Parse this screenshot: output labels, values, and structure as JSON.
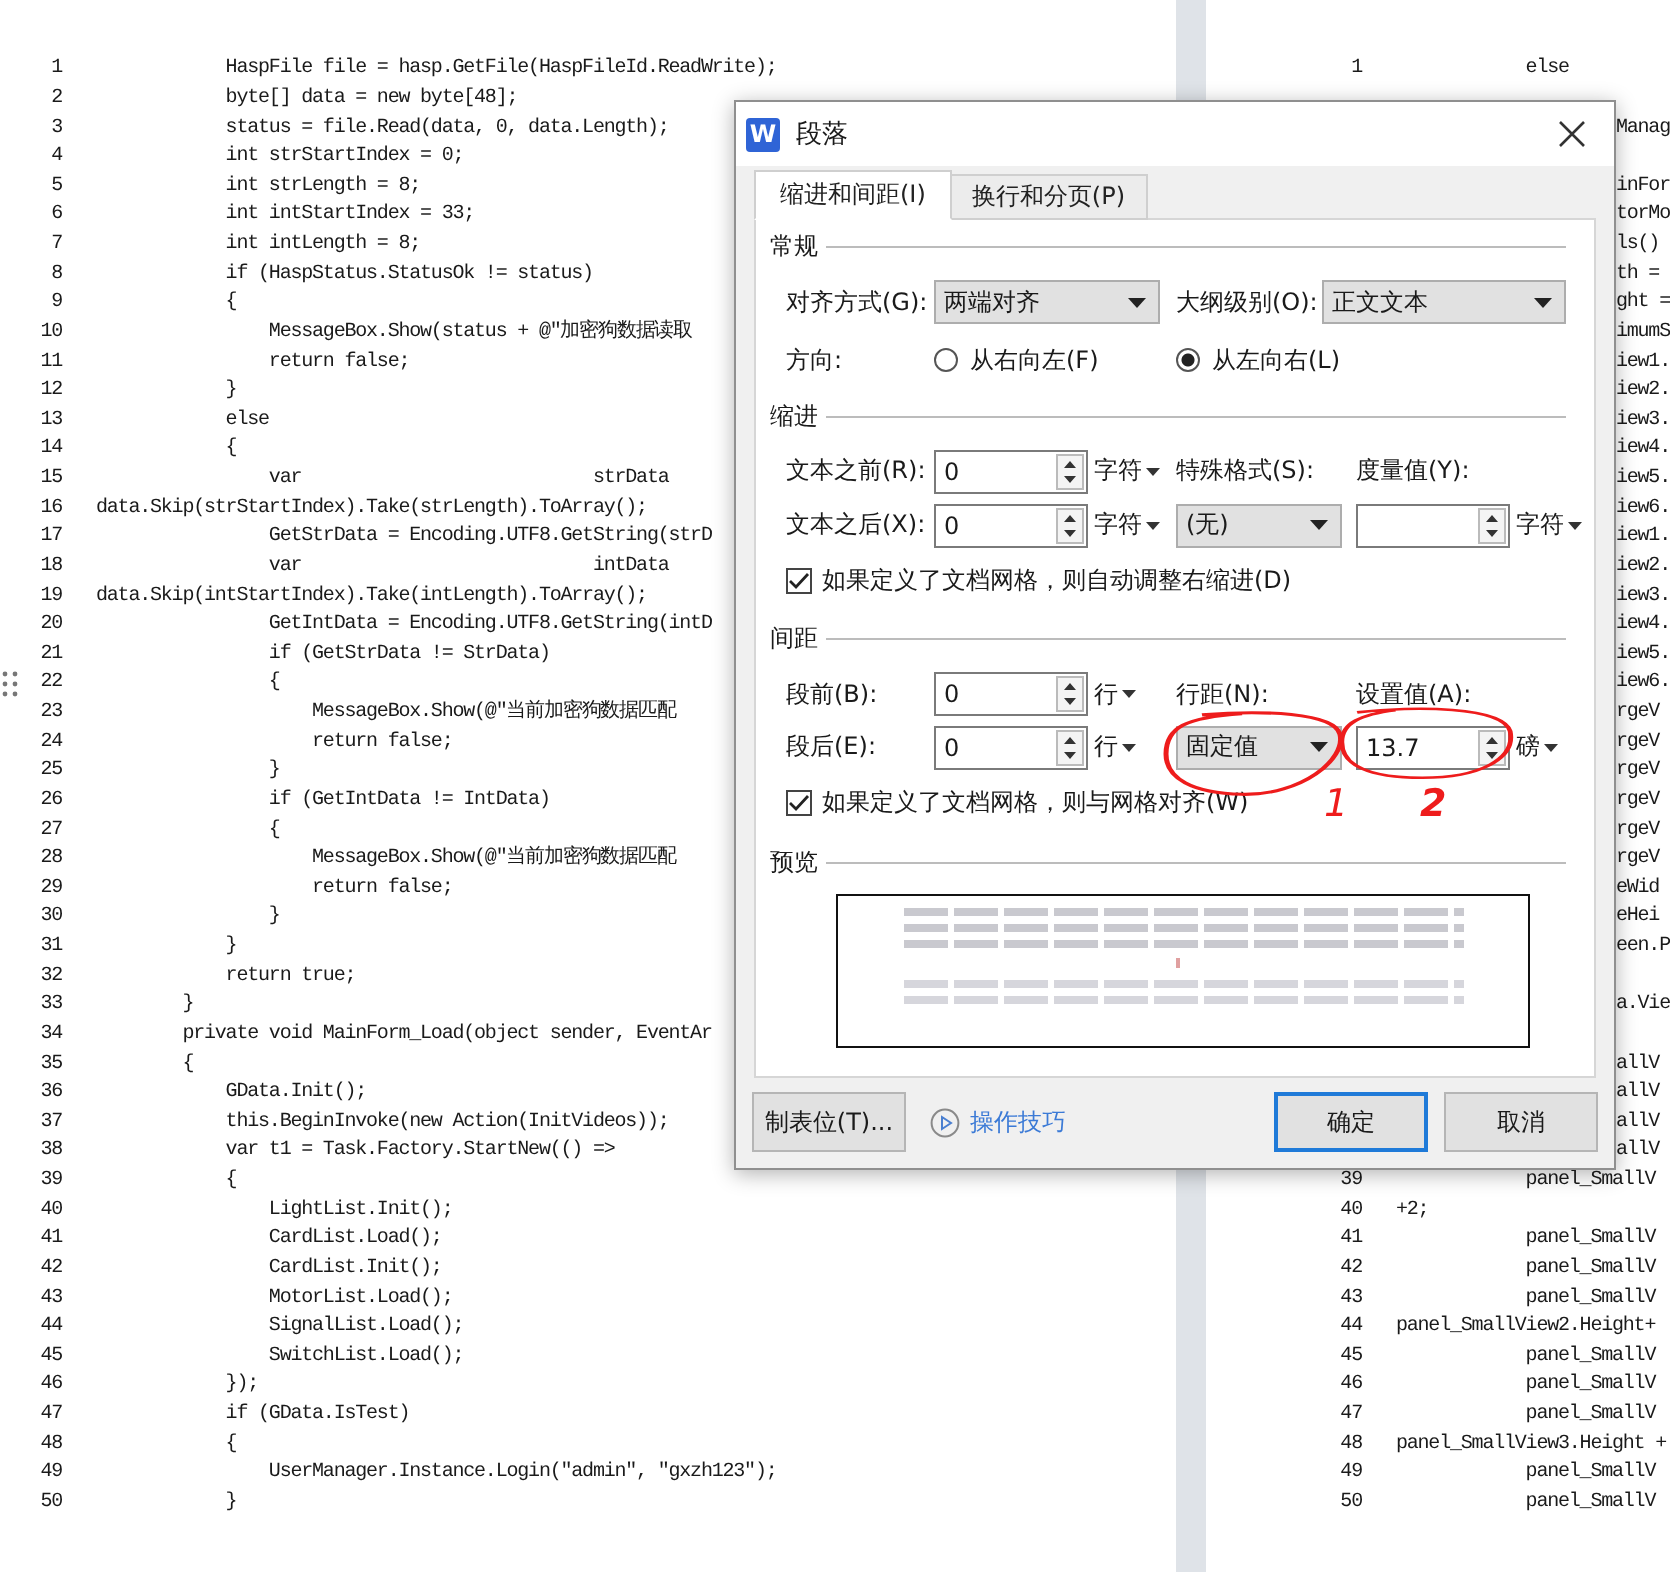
{
  "left_page": {
    "lines": [
      {
        "number": "1",
        "text": "            HaspFile file = hasp.GetFile(HaspFileId.ReadWrite);"
      },
      {
        "number": "2",
        "text": "            byte[] data = new byte[48];"
      },
      {
        "number": "3",
        "text": "            status = file.Read(data, 0, data.Length);"
      },
      {
        "number": "4",
        "text": "            int strStartIndex = 0;"
      },
      {
        "number": "5",
        "text": "            int strLength = 8;"
      },
      {
        "number": "6",
        "text": "            int intStartIndex = 33;"
      },
      {
        "number": "7",
        "text": "            int intLength = 8;"
      },
      {
        "number": "8",
        "text": "            if (HaspStatus.StatusOk != status)"
      },
      {
        "number": "9",
        "text": "            {"
      },
      {
        "number": "10",
        "text": "                MessageBox.Show(status + @\"加密狗数据读取"
      },
      {
        "number": "11",
        "text": "                return false;"
      },
      {
        "number": "12",
        "text": "            }"
      },
      {
        "number": "13",
        "text": "            else"
      },
      {
        "number": "14",
        "text": "            {"
      },
      {
        "number": "15",
        "text": "                var                           strData"
      },
      {
        "number": "16",
        "text": "data.Skip(strStartIndex).Take(strLength).ToArray();"
      },
      {
        "number": "17",
        "text": "                GetStrData = Encoding.UTF8.GetString(strD"
      },
      {
        "number": "18",
        "text": "                var                           intData"
      },
      {
        "number": "19",
        "text": "data.Skip(intStartIndex).Take(intLength).ToArray();"
      },
      {
        "number": "20",
        "text": "                GetIntData = Encoding.UTF8.GetString(intD"
      },
      {
        "number": "21",
        "text": "                if (GetStrData != StrData)"
      },
      {
        "number": "22",
        "text": "                {"
      },
      {
        "number": "23",
        "text": "                    MessageBox.Show(@\"当前加密狗数据匹配"
      },
      {
        "number": "24",
        "text": "                    return false;"
      },
      {
        "number": "25",
        "text": "                }"
      },
      {
        "number": "26",
        "text": "                if (GetIntData != IntData)"
      },
      {
        "number": "27",
        "text": "                {"
      },
      {
        "number": "28",
        "text": "                    MessageBox.Show(@\"当前加密狗数据匹配"
      },
      {
        "number": "29",
        "text": "                    return false;"
      },
      {
        "number": "30",
        "text": "                }"
      },
      {
        "number": "31",
        "text": "            }"
      },
      {
        "number": "32",
        "text": "            return true;"
      },
      {
        "number": "33",
        "text": "        }"
      },
      {
        "number": "34",
        "text": "        private void MainForm_Load(object sender, EventAr"
      },
      {
        "number": "35",
        "text": "        {"
      },
      {
        "number": "36",
        "text": "            GData.Init();"
      },
      {
        "number": "37",
        "text": "            this.BeginInvoke(new Action(InitVideos));"
      },
      {
        "number": "38",
        "text": "            var t1 = Task.Factory.StartNew(() =>"
      },
      {
        "number": "39",
        "text": "            {"
      },
      {
        "number": "40",
        "text": "                LightList.Init();"
      },
      {
        "number": "41",
        "text": "                CardList.Load();"
      },
      {
        "number": "42",
        "text": "                CardList.Init();"
      },
      {
        "number": "43",
        "text": "                MotorList.Load();"
      },
      {
        "number": "44",
        "text": "                SignalList.Load();"
      },
      {
        "number": "45",
        "text": "                SwitchList.Load();"
      },
      {
        "number": "46",
        "text": "            });"
      },
      {
        "number": "47",
        "text": "            if (GData.IsTest)"
      },
      {
        "number": "48",
        "text": "            {"
      },
      {
        "number": "49",
        "text": "                UserManager.Instance.Login(\"admin\", \"gxzh123\");"
      },
      {
        "number": "50",
        "text": "            }"
      }
    ]
  },
  "right_page": {
    "lines": [
      {
        "kind": "full",
        "number": "1",
        "text": "            else"
      },
      {
        "kind": "blank"
      },
      {
        "kind": "fragment",
        "text": "Manag"
      },
      {
        "kind": "blank"
      },
      {
        "kind": "fragment",
        "text": "inFor"
      },
      {
        "kind": "fragment",
        "text": "torMo"
      },
      {
        "kind": "fragment",
        "text": "ls()"
      },
      {
        "kind": "fragment",
        "text": "th ="
      },
      {
        "kind": "fragment",
        "text": "ght ="
      },
      {
        "kind": "fragment",
        "text": "imumS"
      },
      {
        "kind": "fragment",
        "text": "iew1."
      },
      {
        "kind": "fragment",
        "text": "iew2."
      },
      {
        "kind": "fragment",
        "text": "iew3."
      },
      {
        "kind": "fragment",
        "text": "iew4."
      },
      {
        "kind": "fragment",
        "text": "iew5."
      },
      {
        "kind": "fragment",
        "text": "iew6."
      },
      {
        "kind": "fragment",
        "text": "iew1."
      },
      {
        "kind": "fragment",
        "text": "iew2."
      },
      {
        "kind": "fragment",
        "text": "iew3."
      },
      {
        "kind": "fragment",
        "text": "iew4."
      },
      {
        "kind": "fragment",
        "text": "iew5."
      },
      {
        "kind": "fragment",
        "text": "iew6."
      },
      {
        "kind": "fragment",
        "text": "rgeV"
      },
      {
        "kind": "fragment",
        "text": "rgeV"
      },
      {
        "kind": "fragment",
        "text": "rgeV"
      },
      {
        "kind": "fragment",
        "text": "rgeV"
      },
      {
        "kind": "fragment",
        "text": "rgeV"
      },
      {
        "kind": "fragment",
        "text": "rgeV"
      },
      {
        "kind": "fragment",
        "text": "eWid"
      },
      {
        "kind": "fragment",
        "text": "eHei"
      },
      {
        "kind": "fragment",
        "text": "een.P"
      },
      {
        "kind": "blank"
      },
      {
        "kind": "fragment",
        "text": "a.Vie"
      },
      {
        "kind": "blank"
      },
      {
        "kind": "fragment",
        "text": "allV"
      },
      {
        "kind": "fragment",
        "text": "allV"
      },
      {
        "kind": "fragment",
        "text": "allV"
      },
      {
        "kind": "fragment",
        "text": "allV"
      },
      {
        "kind": "full",
        "number": "39",
        "text": "            panel_SmallV"
      },
      {
        "kind": "full",
        "number": "40",
        "text": "+2;"
      },
      {
        "kind": "full",
        "number": "41",
        "text": "            panel_SmallV"
      },
      {
        "kind": "full",
        "number": "42",
        "text": "            panel_SmallV"
      },
      {
        "kind": "full",
        "number": "43",
        "text": "            panel_SmallV"
      },
      {
        "kind": "full",
        "number": "44",
        "text": "panel_SmallView2.Height+"
      },
      {
        "kind": "full",
        "number": "45",
        "text": "            panel_SmallV"
      },
      {
        "kind": "full",
        "number": "46",
        "text": "            panel_SmallV"
      },
      {
        "kind": "full",
        "number": "47",
        "text": "            panel_SmallV"
      },
      {
        "kind": "full",
        "number": "48",
        "text": "panel_SmallView3.Height +"
      },
      {
        "kind": "full",
        "number": "49",
        "text": "            panel_SmallV"
      },
      {
        "kind": "full",
        "number": "50",
        "text": "            panel_SmallV"
      }
    ]
  },
  "dialog": {
    "app_icon": "W",
    "title": "段落",
    "tabs": [
      {
        "label": "缩进和间距(I)",
        "selected": true
      },
      {
        "label": "换行和分页(P)",
        "selected": false
      }
    ],
    "general": {
      "title": "常规",
      "alignment": {
        "label": "对齐方式(G):",
        "value": "两端对齐"
      },
      "outline": {
        "label": "大纲级别(O):",
        "value": "正文文本"
      },
      "direction": {
        "label": "方向:",
        "options": [
          {
            "label": "从右向左(F)",
            "selected": false
          },
          {
            "label": "从左向右(L)",
            "selected": true
          }
        ]
      }
    },
    "indent": {
      "title": "缩进",
      "before": {
        "label": "文本之前(R):",
        "value": "0",
        "unit": "字符"
      },
      "after": {
        "label": "文本之后(X):",
        "value": "0",
        "unit": "字符"
      },
      "special": {
        "label": "特殊格式(S):",
        "value": "(无)"
      },
      "measure": {
        "label": "度量值(Y):",
        "unit": "字符"
      },
      "auto_adjust": {
        "label": "如果定义了文档网格，则自动调整右缩进(D)",
        "checked": true
      }
    },
    "spacing": {
      "title": "间距",
      "before": {
        "label": "段前(B):",
        "value": "0",
        "unit": "行"
      },
      "after": {
        "label": "段后(E):",
        "value": "0",
        "unit": "行"
      },
      "line_spacing": {
        "label": "行距(N):",
        "value": "固定值"
      },
      "set_value": {
        "label": "设置值(A):",
        "value": "13.7",
        "unit": "磅"
      },
      "snap_to_grid": {
        "label": "如果定义了文档网格，则与网格对齐(W)",
        "checked": true
      }
    },
    "preview": {
      "title": "预览"
    },
    "tab_stops_button": "制表位(T)...",
    "tips_link": "操作技巧",
    "buttons": [
      {
        "label": "确定",
        "primary": true
      },
      {
        "label": "取消",
        "primary": false
      }
    ]
  },
  "annotations": [
    {
      "label": "1"
    },
    {
      "label": "2"
    }
  ]
}
